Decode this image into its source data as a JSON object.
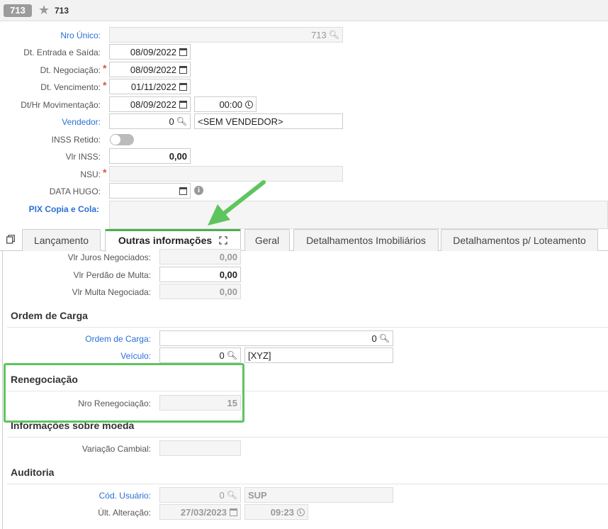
{
  "header": {
    "record_badge": "713",
    "title": "713"
  },
  "form": {
    "nro_unico": {
      "label": "Nro Único:",
      "value": "713"
    },
    "dt_entrada": {
      "label": "Dt. Entrada e Saída:",
      "value": "08/09/2022"
    },
    "dt_negociacao": {
      "label": "Dt. Negociação:",
      "value": "08/09/2022"
    },
    "dt_vencimento": {
      "label": "Dt. Vencimento:",
      "value": "01/11/2022"
    },
    "dthr_mov": {
      "label": "Dt/Hr Movimentação:",
      "date": "08/09/2022",
      "time": "00:00"
    },
    "vendedor": {
      "label": "Vendedor:",
      "code": "0",
      "name": "<SEM VENDEDOR>"
    },
    "inss_retido": {
      "label": "INSS Retido:"
    },
    "vlr_inss": {
      "label": "Vlr INSS:",
      "value": "0,00"
    },
    "nsu": {
      "label": "NSU:",
      "value": ""
    },
    "data_hugo": {
      "label": "DATA HUGO:",
      "value": ""
    },
    "pix": {
      "label": "PIX Copia e Cola:",
      "value": ""
    },
    "required_mark": "*"
  },
  "tabs": [
    {
      "label": "Lançamento"
    },
    {
      "label": "Outras informações"
    },
    {
      "label": "Geral"
    },
    {
      "label": "Detalhamentos Imobiliários"
    },
    {
      "label": "Detalhamentos p/ Loteamento"
    }
  ],
  "outras": {
    "juros": {
      "label": "Vlr Juros Negociados:",
      "value": "0,00"
    },
    "perdao": {
      "label": "Vlr Perdão de Multa:",
      "value": "0,00"
    },
    "multa": {
      "label": "Vlr Multa Negociada:",
      "value": "0,00"
    },
    "ordem_carga": {
      "title": "Ordem de Carga",
      "ordem": {
        "label": "Ordem de Carga:",
        "value": "0"
      },
      "veiculo": {
        "label": "Veículo:",
        "code": "0",
        "name": "[XYZ]"
      }
    },
    "renegociacao": {
      "title": "Renegociação",
      "nro": {
        "label": "Nro Renegociação:",
        "value": "15"
      }
    },
    "moeda": {
      "title": "Informações sobre moeda",
      "variacao": {
        "label": "Variação Cambial:",
        "value": ""
      }
    },
    "auditoria": {
      "title": "Auditoria",
      "usuario": {
        "label": "Cód. Usuário:",
        "code": "0",
        "name": "SUP"
      },
      "ultima": {
        "label": "Últ. Alteração:",
        "date": "27/03/2023",
        "time": "09:23"
      }
    }
  },
  "colors": {
    "accent_green": "#5ec55e",
    "link_blue": "#2a6fd6",
    "required_red": "#d9534f"
  }
}
